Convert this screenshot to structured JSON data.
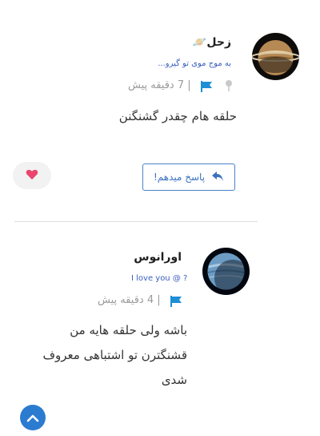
{
  "comments": [
    {
      "author": "زحل🪐",
      "subtitle": "به موج موی تو گیرو...",
      "time": "| 7 دقیقه پیش",
      "text": "حلقه هام چقدر گشنگنن",
      "reply_label": "پاسخ میدهم!",
      "avatar_icon": "saturn-avatar",
      "liked": true
    },
    {
      "author": "اورانوس",
      "subtitle": "I love you @ ?",
      "time": "| 4 دقیقه پیش",
      "text_lines": [
        "باشه ولی حلقه هایه من",
        "قشنگترن تو اشتباهی معروف",
        "شدی"
      ],
      "avatar_icon": "uranus-avatar"
    }
  ],
  "colors": {
    "accent": "#2b7bd0",
    "flag": "#1e8fd6",
    "heart": "#e9456f"
  }
}
